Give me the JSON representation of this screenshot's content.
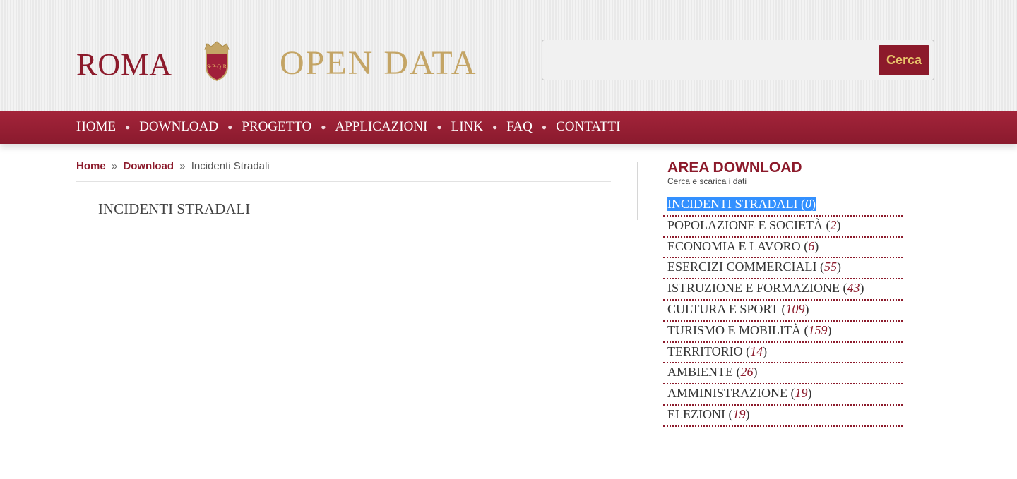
{
  "header": {
    "logo_roma": "ROMA",
    "logo_open_data": "OPEN DATA",
    "search_placeholder": "",
    "search_button": "Cerca"
  },
  "nav": {
    "items": [
      "HOME",
      "DOWNLOAD",
      "PROGETTO",
      "APPLICAZIONI",
      "LINK",
      "FAQ",
      "CONTATTI"
    ]
  },
  "breadcrumb": {
    "home": "Home",
    "sep": "»",
    "download": "Download",
    "current": "Incidenti Stradali"
  },
  "main": {
    "title": "INCIDENTI STRADALI"
  },
  "sidebar": {
    "title": "AREA DOWNLOAD",
    "subtitle": "Cerca e scarica i dati",
    "categories": [
      {
        "name": "INCIDENTI STRADALI",
        "count": "0",
        "selected": true
      },
      {
        "name": "POPOLAZIONE E SOCIETÀ",
        "count": "2"
      },
      {
        "name": "ECONOMIA E LAVORO",
        "count": "6"
      },
      {
        "name": "ESERCIZI COMMERCIALI",
        "count": "55"
      },
      {
        "name": "ISTRUZIONE E FORMAZIONE",
        "count": "43"
      },
      {
        "name": "CULTURA E SPORT",
        "count": "109"
      },
      {
        "name": "TURISMO E MOBILITÀ",
        "count": "159"
      },
      {
        "name": "TERRITORIO",
        "count": "14"
      },
      {
        "name": "AMBIENTE",
        "count": "26"
      },
      {
        "name": "AMMINISTRAZIONE",
        "count": "19"
      },
      {
        "name": "ELEZIONI",
        "count": "19"
      }
    ]
  },
  "colors": {
    "brand_red": "#8c1a2b",
    "brand_gold": "#c4a566",
    "selection_blue": "#3390ff"
  }
}
